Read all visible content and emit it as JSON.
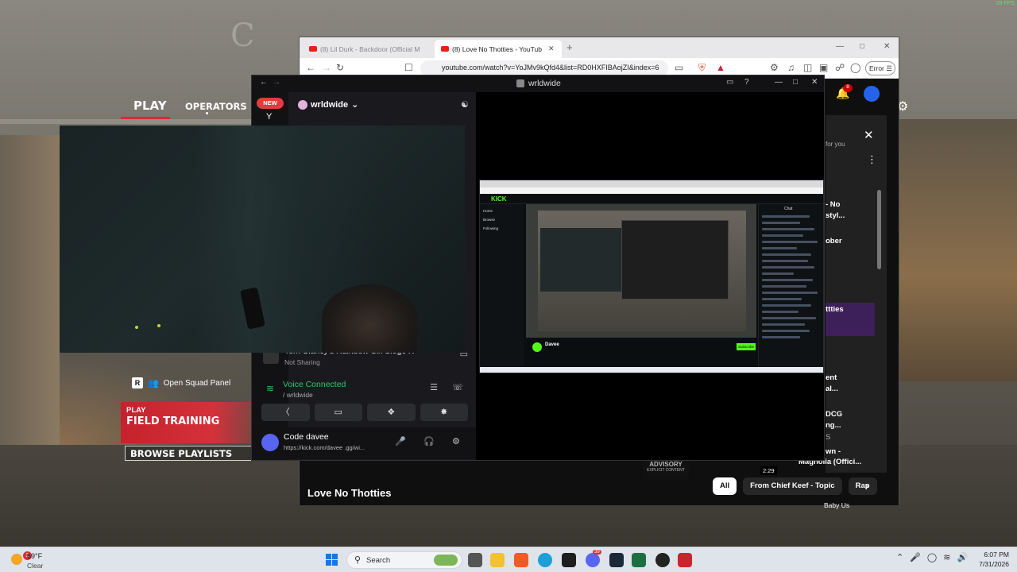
{
  "game": {
    "sign_text": "C",
    "fps": "29 FPS",
    "nav": {
      "play": "PLAY",
      "operators": "OPERATORS"
    },
    "squad": {
      "key": "R",
      "label": "Open Squad Panel"
    },
    "field_card": {
      "small": "PLAY",
      "big": "FIELD TRAINING"
    },
    "browse": "BROWSE PLAYLISTS"
  },
  "browser": {
    "tabs": [
      {
        "label": "(8) Lil Durk - Backdoor (Official M",
        "active": false
      },
      {
        "label": "(8) Love No Thotties - YouTub",
        "active": true
      }
    ],
    "new_tab": "+",
    "url": "youtube.com/watch?v=YoJMv9kQfd4&list=RD0HXFIBAojZI&index=6",
    "error_label": "Error",
    "shield_count": "21"
  },
  "youtube": {
    "notifications": "8",
    "title": "Love No Thotties",
    "for_you": "for you",
    "advisory": {
      "top": "ADVISORY",
      "bottom": "EXPLICIT CONTENT"
    },
    "duration": "2:29",
    "chips": [
      {
        "label": "All",
        "active": true
      },
      {
        "label": "From Chief Keef - Topic",
        "active": false
      },
      {
        "label": "Rap",
        "active": false
      }
    ],
    "list_fragments": [
      "- No",
      "styl...",
      "ober",
      "ttties",
      "ent",
      "al...",
      "DCG",
      "ng...",
      "S",
      "wn -",
      "Magnolia (Offici..."
    ],
    "baby_us": "Baby Us"
  },
  "discord": {
    "title": "wrldwide",
    "new_badge": "NEW",
    "server_letter": "Y",
    "server_name": "wrldwide",
    "activity": {
      "title": "Tom Clancy's Rainbow Six Siege X",
      "status": "Not Sharing"
    },
    "voice": {
      "title": "Voice Connected",
      "channel": "/ wrldwide"
    },
    "user": {
      "name": "Code davee",
      "status": "https://kick.com/davee .gg/wi..."
    }
  },
  "stream": {
    "logo": "KICK",
    "sidebar_items": [
      "Home",
      "Browse",
      "Following"
    ],
    "chat_header": "Chat",
    "streamer": "Davee",
    "subscribe": "Subscribe",
    "title": "Love No Thotties"
  },
  "taskbar": {
    "weather_temp": "69°F",
    "weather_cond": "Clear",
    "weather_badge": "2",
    "search_label": "Search",
    "time": "6:07 PM",
    "date": "7/31/2026",
    "discord_badge": "39"
  },
  "colors": {
    "r6_red": "#d5313a",
    "kick_green": "#53fc18",
    "discord_green": "#2dc770",
    "yt_red": "#e62117"
  }
}
